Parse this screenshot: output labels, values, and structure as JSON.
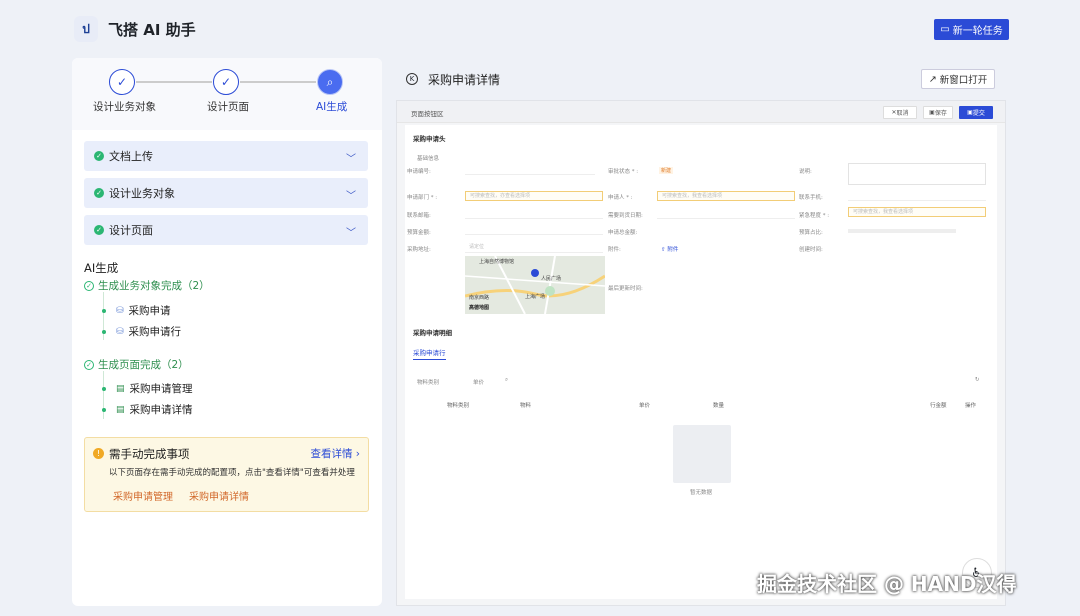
{
  "app": {
    "title": "飞搭 AI 助手",
    "logo_text": "ป",
    "new_task": "新一轮任务"
  },
  "steps": [
    {
      "label": "设计业务对象",
      "state": "done"
    },
    {
      "label": "设计页面",
      "state": "done"
    },
    {
      "label": "AI生成",
      "state": "active"
    }
  ],
  "accordions": [
    {
      "label": "文档上传"
    },
    {
      "label": "设计业务对象"
    },
    {
      "label": "设计页面"
    }
  ],
  "ai": {
    "title": "AI生成",
    "group1": "生成业务对象完成（2）",
    "group1_items": [
      "采购申请",
      "采购申请行"
    ],
    "group2": "生成页面完成（2）",
    "group2_items": [
      "采购申请管理",
      "采购申请详情"
    ]
  },
  "notice": {
    "title": "需手动完成事项",
    "link": "查看详情",
    "desc": "以下页面存在需手动完成的配置项，点击\"查看详情\"可查看并处理",
    "tags": [
      "采购申请管理",
      "采购申请详情"
    ]
  },
  "right": {
    "title": "采购申请详情",
    "open_new": "新窗口打开"
  },
  "preview": {
    "toolbar_label": "页面按钮区",
    "cancel": "取消",
    "save": "保存",
    "submit": "提交",
    "section1": "采购申请头",
    "basic_info": "基础信息",
    "fields": {
      "req_no": "申请编号:",
      "status": "审批状态 * :",
      "status_val": "新建",
      "desc": "说明:",
      "dept": "申请部门 * :",
      "dept_ph": "可搜索查找，亦查看选择项",
      "applicant": "申请人 * :",
      "applicant_ph": "可搜索查找，我查看选择项",
      "phone": "联系手机:",
      "email": "联系邮箱:",
      "date": "需要到货日期:",
      "urgency": "紧急程度 * :",
      "urgency_ph": "可搜索查找，我查看选择项",
      "budget": "预算金额:",
      "total": "申请总金额:",
      "ratio": "预算占比:",
      "address": "采购地址:",
      "address_ph": "请定位",
      "attach": "附件:",
      "attach_link": "附件",
      "created": "创建时间:",
      "updated": "最后更新时间:"
    },
    "map": {
      "label1": "上海自然博物馆",
      "label2": "人民广场",
      "label3": "上海广场",
      "label4": "南京西路",
      "label5": "高德地图"
    },
    "section2": "采购申请明细",
    "tab": "采购申请行",
    "filters": [
      "物料类别",
      "单价"
    ],
    "columns": [
      "物料类别",
      "物料",
      "单价",
      "数量",
      "行金额",
      "操作"
    ],
    "empty": "暂无数据"
  },
  "watermark": "掘金技术社区 @ HAND汉得"
}
